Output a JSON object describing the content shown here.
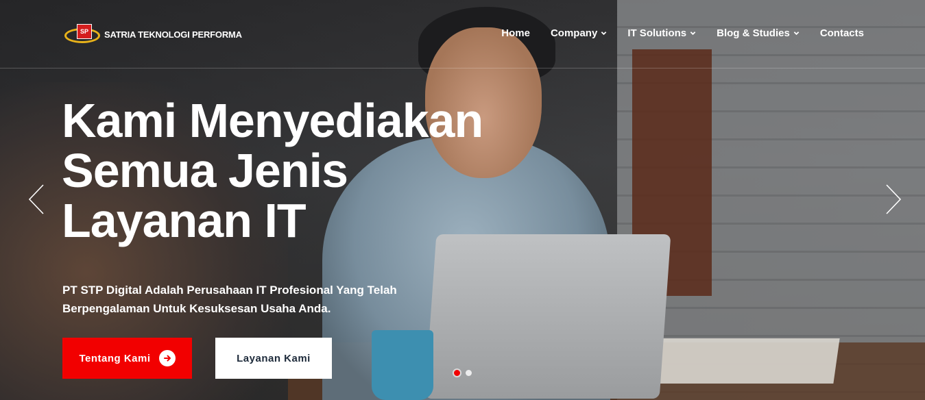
{
  "brand": {
    "logo_initials": "SP",
    "name": "SATRIA TEKNOLOGI PERFORMA",
    "accent_red": "#f20000",
    "logo_gold": "#e8b21a"
  },
  "nav": {
    "items": [
      {
        "label": "Home",
        "has_dropdown": false
      },
      {
        "label": "Company",
        "has_dropdown": true
      },
      {
        "label": "IT Solutions",
        "has_dropdown": true
      },
      {
        "label": "Blog & Studies",
        "has_dropdown": true
      },
      {
        "label": "Contacts",
        "has_dropdown": false
      }
    ]
  },
  "hero": {
    "title_line1": "Kami Menyediakan",
    "title_line2": "Semua Jenis",
    "title_line3": "Layanan IT",
    "subtitle_line1": "PT STP Digital Adalah Perusahaan IT Profesional Yang Telah",
    "subtitle_line2": "Berpengalaman Untuk Kesuksesan Usaha Anda.",
    "primary_button": "Tentang Kami",
    "secondary_button": "Layanan Kami"
  },
  "slider": {
    "prev_icon": "chevron-left-icon",
    "next_icon": "chevron-right-icon",
    "active_slide": 1,
    "slide_count": 2
  }
}
